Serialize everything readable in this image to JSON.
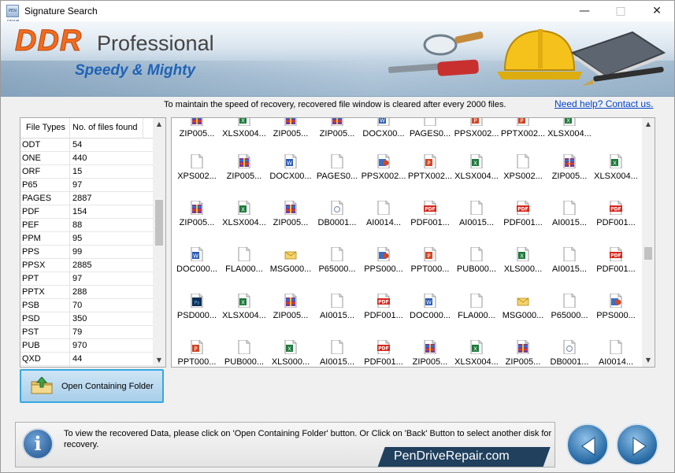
{
  "window": {
    "title": "Signature Search",
    "app_icon_text": "PEN DRIVE"
  },
  "banner": {
    "brand_ddr": "DDR",
    "brand_professional": "Professional",
    "tagline": "Speedy & Mighty"
  },
  "notice": {
    "text": "To maintain the speed of recovery, recovered file window is cleared after every 2000 files.",
    "help_link": "Need help? Contact us."
  },
  "file_types_table": {
    "columns": [
      "File Types",
      "No. of files found"
    ],
    "rows": [
      {
        "type": "ODT",
        "count": "54"
      },
      {
        "type": "ONE",
        "count": "440"
      },
      {
        "type": "ORF",
        "count": "15"
      },
      {
        "type": "P65",
        "count": "97"
      },
      {
        "type": "PAGES",
        "count": "2887"
      },
      {
        "type": "PDF",
        "count": "154"
      },
      {
        "type": "PEF",
        "count": "88"
      },
      {
        "type": "PPM",
        "count": "95"
      },
      {
        "type": "PPS",
        "count": "99"
      },
      {
        "type": "PPSX",
        "count": "2885"
      },
      {
        "type": "PPT",
        "count": "97"
      },
      {
        "type": "PPTX",
        "count": "288"
      },
      {
        "type": "PSB",
        "count": "70"
      },
      {
        "type": "PSD",
        "count": "350"
      },
      {
        "type": "PST",
        "count": "79"
      },
      {
        "type": "PUB",
        "count": "970"
      },
      {
        "type": "QXD",
        "count": "44"
      }
    ]
  },
  "open_folder_button": {
    "label": "Open Containing Folder"
  },
  "recovered_files": {
    "rows": [
      [
        {
          "name": "ZIP005...",
          "icon": "zip"
        },
        {
          "name": "XLSX004...",
          "icon": "xls"
        },
        {
          "name": "ZIP005...",
          "icon": "zip"
        },
        {
          "name": "ZIP005...",
          "icon": "zip"
        },
        {
          "name": "DOCX00...",
          "icon": "doc"
        },
        {
          "name": "PAGES0...",
          "icon": "blank"
        },
        {
          "name": "PPSX002...",
          "icon": "ppt"
        },
        {
          "name": "PPTX002...",
          "icon": "ppt"
        },
        {
          "name": "XLSX004...",
          "icon": "xls"
        }
      ],
      [
        {
          "name": "XPS002...",
          "icon": "blank"
        },
        {
          "name": "ZIP005...",
          "icon": "zip"
        },
        {
          "name": "DOCX00...",
          "icon": "doc"
        },
        {
          "name": "PAGES0...",
          "icon": "blank"
        },
        {
          "name": "PPSX002...",
          "icon": "pps"
        },
        {
          "name": "PPTX002...",
          "icon": "ppt"
        },
        {
          "name": "XLSX004...",
          "icon": "xls"
        },
        {
          "name": "XPS002...",
          "icon": "blank"
        },
        {
          "name": "ZIP005...",
          "icon": "zip"
        },
        {
          "name": "XLSX004...",
          "icon": "xls"
        }
      ],
      [
        {
          "name": "ZIP005...",
          "icon": "zip"
        },
        {
          "name": "XLSX004...",
          "icon": "xls"
        },
        {
          "name": "ZIP005...",
          "icon": "zip"
        },
        {
          "name": "DB0001...",
          "icon": "db"
        },
        {
          "name": "AI0014...",
          "icon": "blank"
        },
        {
          "name": "PDF001...",
          "icon": "pdf"
        },
        {
          "name": "AI0015...",
          "icon": "blank"
        },
        {
          "name": "PDF001...",
          "icon": "pdf"
        },
        {
          "name": "AI0015...",
          "icon": "blank"
        },
        {
          "name": "PDF001...",
          "icon": "pdf"
        }
      ],
      [
        {
          "name": "DOC000...",
          "icon": "doc"
        },
        {
          "name": "FLA000...",
          "icon": "blank"
        },
        {
          "name": "MSG000...",
          "icon": "msg"
        },
        {
          "name": "P65000...",
          "icon": "blank"
        },
        {
          "name": "PPS000...",
          "icon": "pps"
        },
        {
          "name": "PPT000...",
          "icon": "ppt"
        },
        {
          "name": "PUB000...",
          "icon": "blank"
        },
        {
          "name": "XLS000...",
          "icon": "xls"
        },
        {
          "name": "AI0015...",
          "icon": "blank"
        },
        {
          "name": "PDF001...",
          "icon": "pdf"
        }
      ],
      [
        {
          "name": "PSD000...",
          "icon": "psd"
        },
        {
          "name": "XLSX004...",
          "icon": "xls"
        },
        {
          "name": "ZIP005...",
          "icon": "zip"
        },
        {
          "name": "AI0015...",
          "icon": "blank"
        },
        {
          "name": "PDF001...",
          "icon": "pdf"
        },
        {
          "name": "DOC000...",
          "icon": "doc"
        },
        {
          "name": "FLA000...",
          "icon": "blank"
        },
        {
          "name": "MSG000...",
          "icon": "msg"
        },
        {
          "name": "P65000...",
          "icon": "blank"
        },
        {
          "name": "PPS000...",
          "icon": "pps"
        }
      ],
      [
        {
          "name": "PPT000...",
          "icon": "ppt"
        },
        {
          "name": "PUB000...",
          "icon": "blank"
        },
        {
          "name": "XLS000...",
          "icon": "xls"
        },
        {
          "name": "AI0015...",
          "icon": "blank"
        },
        {
          "name": "PDF001...",
          "icon": "pdf"
        },
        {
          "name": "ZIP005...",
          "icon": "zip"
        },
        {
          "name": "XLSX004...",
          "icon": "xls"
        },
        {
          "name": "ZIP005...",
          "icon": "zip"
        },
        {
          "name": "DB0001...",
          "icon": "db"
        },
        {
          "name": "AI0014...",
          "icon": "blank"
        }
      ]
    ]
  },
  "footer": {
    "instruction": "To view the recovered Data, please click on 'Open Containing Folder' button. Or Click on 'Back' Button to select another disk for recovery.",
    "brand": "PenDriveRepair.com"
  },
  "colors": {
    "accent_blue": "#35a8e0",
    "brand_orange": "#f26b1f",
    "tagline_blue": "#1f63b5",
    "link_blue": "#0044cc"
  }
}
